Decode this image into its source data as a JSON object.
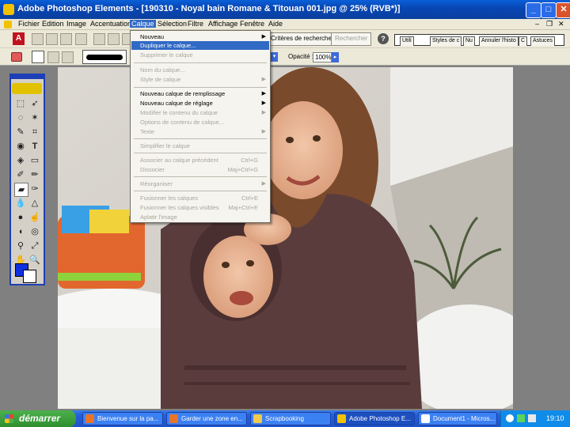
{
  "window": {
    "title": "Adobe Photoshop Elements - [190310 - Noyal bain Romane & Titouan 001.jpg @ 25% (RVB*)]",
    "minimize_label": "_",
    "maximize_label": "□",
    "close_label": "✕"
  },
  "menubar": {
    "items": [
      "Fichier",
      "Edition",
      "Image",
      "Accentuation",
      "Calque",
      "Sélection",
      "Filtre",
      "Affichage",
      "Fenêtre",
      "Aide"
    ],
    "active": "Calque",
    "mdi_minimize": "–",
    "mdi_restore": "❐",
    "mdi_close": "✕"
  },
  "toolbar": {
    "search_criteria_button": "Critères de recherche",
    "search_button": "Rechercher",
    "help_icon": "?",
    "palette_tabs": [
      "Utili",
      "Styles de c",
      "Nu",
      "Annuler l'histo",
      "C",
      "Astuces"
    ],
    "opacity_label": "Opacité :",
    "opacity_value": "100%"
  },
  "layer_menu": {
    "items": [
      {
        "label": "Nouveau",
        "enabled": true,
        "submenu": true
      },
      {
        "label": "Dupliquer le calque...",
        "enabled": true,
        "highlighted": true
      },
      {
        "label": "Supprimer le calque",
        "enabled": false
      },
      {
        "separator": true
      },
      {
        "label": "Nom du calque...",
        "enabled": false
      },
      {
        "label": "Style de calque",
        "enabled": false,
        "submenu": true
      },
      {
        "separator": true
      },
      {
        "label": "Nouveau calque de remplissage",
        "enabled": true,
        "submenu": true
      },
      {
        "label": "Nouveau calque de réglage",
        "enabled": true,
        "submenu": true
      },
      {
        "label": "Modifier le contenu du calque",
        "enabled": false,
        "submenu": true
      },
      {
        "label": "Options de contenu de calque...",
        "enabled": false
      },
      {
        "label": "Texte",
        "enabled": false,
        "submenu": true
      },
      {
        "separator": true
      },
      {
        "label": "Simplifier le calque",
        "enabled": false
      },
      {
        "separator": true
      },
      {
        "label": "Associer au calque précédent",
        "enabled": false,
        "shortcut": "Ctrl+G"
      },
      {
        "label": "Dissocier",
        "enabled": false,
        "shortcut": "Maj+Ctrl+G"
      },
      {
        "separator": true
      },
      {
        "label": "Réorganiser",
        "enabled": false,
        "submenu": true
      },
      {
        "separator": true
      },
      {
        "label": "Fusionner les calques",
        "enabled": false,
        "shortcut": "Ctrl+E"
      },
      {
        "label": "Fusionner les calques visibles",
        "enabled": false,
        "shortcut": "Maj+Ctrl+E"
      },
      {
        "label": "Aplatir l'image",
        "enabled": false
      }
    ]
  },
  "taskbar": {
    "start_label": "démarrer",
    "tasks": [
      {
        "label": "Bienvenue sur la pa...",
        "icon_color": "#e8742a"
      },
      {
        "label": "Garder une zone en...",
        "icon_color": "#e8742a"
      },
      {
        "label": "Scrapbooking",
        "icon_color": "#f2c94c"
      },
      {
        "label": "Adobe Photoshop E...",
        "icon_color": "#f2c200",
        "active": true
      },
      {
        "label": "Document1 - Micros...",
        "icon_color": "#ffffff"
      }
    ],
    "clock": "19:10"
  },
  "colors": {
    "foreground_swatch": "#1030e0",
    "background_swatch": "#ffffff",
    "towel": "#5a3c3c",
    "menu_highlight": "#316ac5"
  }
}
